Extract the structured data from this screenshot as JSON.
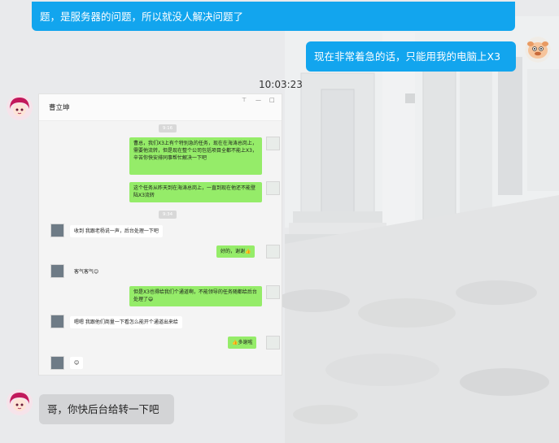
{
  "chat": {
    "top_message": "题，是服务器的问题，所以就没人解决问题了",
    "my_message": "现在非常着急的话，只能用我的电脑上X3",
    "timestamp": "10:03:23",
    "bottom_message": "哥，你快后台给转一下吧"
  },
  "screenshot": {
    "title": "曹立坤",
    "controls": {
      "pin": "⊤",
      "minimize": "—",
      "maximize": "□"
    },
    "time_1": "9:16",
    "time_2": "9:34",
    "messages": [
      {
        "side": "right",
        "text": "曹总，我们X3上有个特别急的任务，现在在海涛总岗上，需要他流转，但是现在整个公司包括项目全都不能上X3，辛苦你快安排同事帮忙解决一下吧"
      },
      {
        "side": "right",
        "text": "这个任务从昨天到在海涛总岗上，一直到现在他还不能登陆X3流转"
      },
      {
        "side": "left",
        "text": "收到 我跟老杨说一声，后台处理一下吧"
      },
      {
        "side": "right",
        "text": "好的，谢谢👍"
      },
      {
        "side": "left",
        "text": "客气客气😊"
      },
      {
        "side": "right",
        "text": "但是X3也得给我们个通道啊，不能领导的任务随都给后台处理了😄"
      },
      {
        "side": "left",
        "text": "嗯嗯 我跟他们商量一下看怎么能开个通道出来给"
      },
      {
        "side": "right",
        "text": "👍多谢啦"
      },
      {
        "side": "left",
        "text": "😊"
      }
    ]
  },
  "colors": {
    "blue_bubble": "#12a5ee",
    "gray_bubble": "#d3d4d6",
    "wechat_green": "#95ec69"
  }
}
